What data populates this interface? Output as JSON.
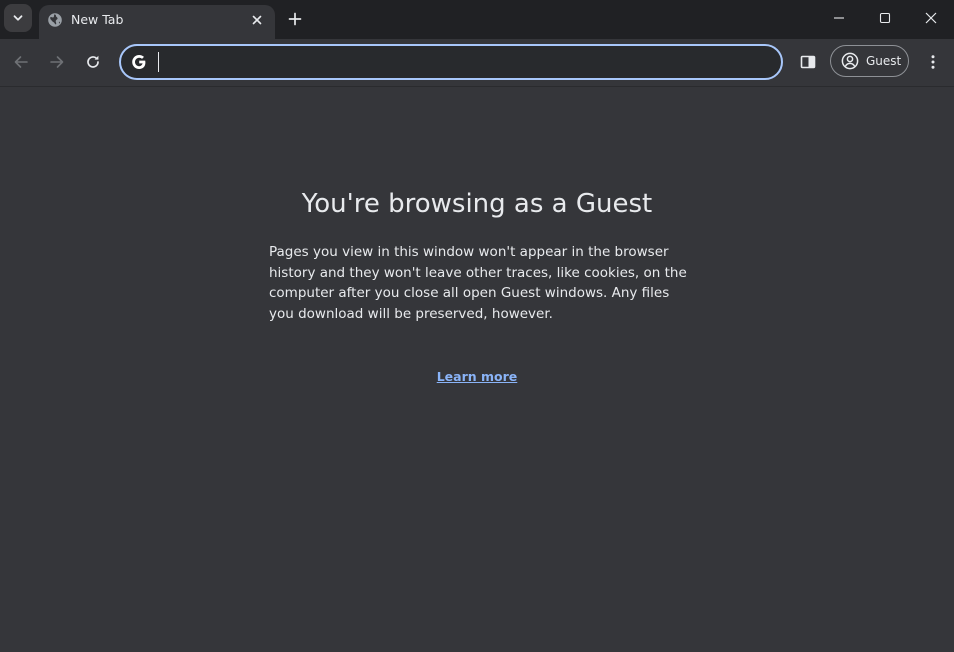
{
  "tab": {
    "title": "New Tab",
    "favicon": "globe-icon"
  },
  "omnibox": {
    "value": "",
    "placeholder": ""
  },
  "profile": {
    "label": "Guest"
  },
  "content": {
    "title": "You're browsing as a Guest",
    "description": "Pages you view in this window won't appear in the browser history and they won't leave other traces, like cookies, on the computer after you close all open Guest windows. Any files you download will be preserved, however.",
    "link_label": "Learn more"
  },
  "colors": {
    "background": "#35363a",
    "tabstrip": "#202124",
    "omnibox_border": "#a8c7fa",
    "link": "#8ab4f8",
    "text": "#e8eaed"
  }
}
